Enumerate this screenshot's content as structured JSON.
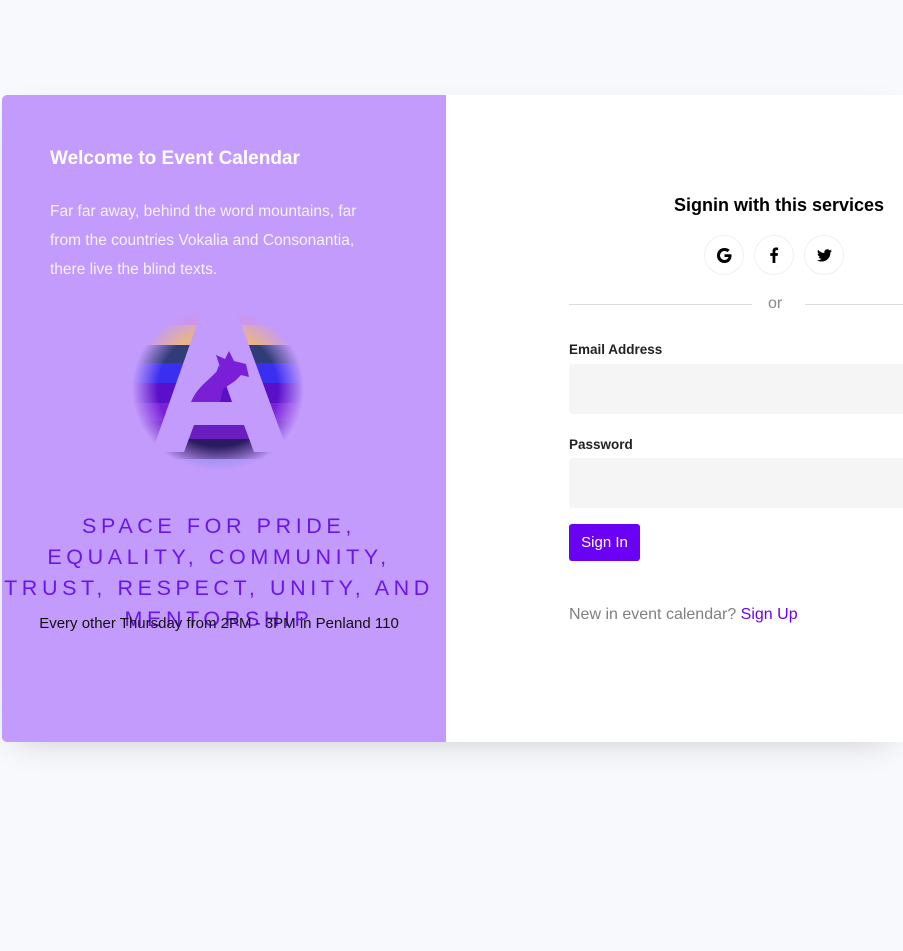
{
  "welcome": {
    "title": "Welcome to Event Calendar",
    "text": "Far far away, behind the word mountains, far from the countries Vokalia and Consonantia, there live the blind texts."
  },
  "tagline": "SPACE FOR PRIDE, EQUALITY, COMMUNITY, TRUST, RESPECT, UNITY, AND MENTORSHIP",
  "meeting_info": "Every other Thursday from 2PM - 3PM in Penland 110",
  "signin": {
    "title": "Signin with this services",
    "social": [
      {
        "name": "google",
        "icon": "google-icon"
      },
      {
        "name": "facebook",
        "icon": "facebook-icon"
      },
      {
        "name": "twitter",
        "icon": "twitter-icon"
      }
    ],
    "divider_text": "or",
    "email_label": "Email Address",
    "email_value": "",
    "password_label": "Password",
    "password_value": "",
    "button_label": "Sign In",
    "signup_prompt": "New in event calendar?",
    "signup_link": "Sign Up"
  },
  "colors": {
    "left_panel": "#c39bfc",
    "accent": "#6a00f4",
    "background": "#f8f9fd",
    "input_bg": "#f5f5f5"
  }
}
